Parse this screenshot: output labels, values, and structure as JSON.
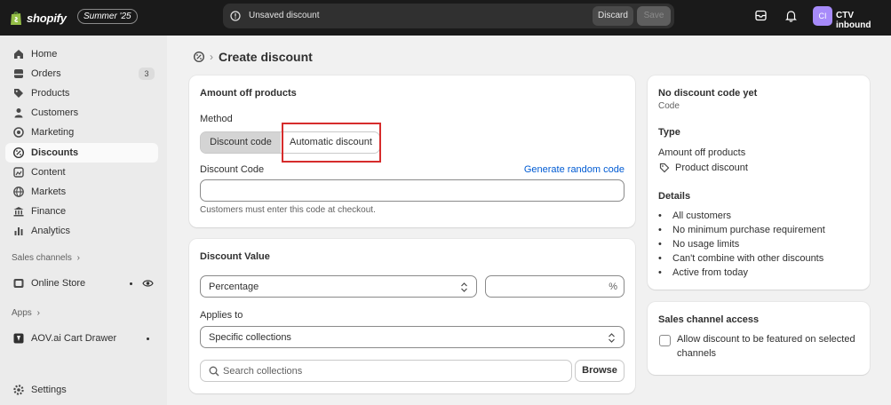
{
  "topbar": {
    "logo_text": "shopify",
    "edition": "Summer '25",
    "unsaved_text": "Unsaved discount",
    "discard_label": "Discard",
    "save_label": "Save",
    "avatar_initials": "CI",
    "store_name": "CTV inbound"
  },
  "sidebar": {
    "items": [
      {
        "label": "Home",
        "icon": "home-icon"
      },
      {
        "label": "Orders",
        "icon": "orders-icon",
        "badge": "3"
      },
      {
        "label": "Products",
        "icon": "tag-icon"
      },
      {
        "label": "Customers",
        "icon": "person-icon"
      },
      {
        "label": "Marketing",
        "icon": "target-icon"
      },
      {
        "label": "Discounts",
        "icon": "discount-icon",
        "active": true
      },
      {
        "label": "Content",
        "icon": "content-icon"
      },
      {
        "label": "Markets",
        "icon": "globe-icon"
      },
      {
        "label": "Finance",
        "icon": "bank-icon"
      },
      {
        "label": "Analytics",
        "icon": "bar-chart-icon"
      }
    ],
    "sales_channels_header": "Sales channels",
    "online_store": "Online Store",
    "apps_header": "Apps",
    "app_name": "AOV.ai Cart Drawer",
    "settings": "Settings"
  },
  "page": {
    "title": "Create discount"
  },
  "method_card": {
    "title": "Amount off products",
    "method_label": "Method",
    "seg_discount_code": "Discount code",
    "seg_automatic": "Automatic discount",
    "code_label": "Discount Code",
    "generate_link": "Generate random code",
    "code_value": "",
    "helper": "Customers must enter this code at checkout."
  },
  "value_card": {
    "title": "Discount Value",
    "type_selected": "Percentage",
    "value": "",
    "suffix": "%",
    "applies_label": "Applies to",
    "applies_selected": "Specific collections",
    "search_placeholder": "Search collections",
    "browse_label": "Browse"
  },
  "summary_card": {
    "code_title": "No discount code yet",
    "code_sub": "Code",
    "type_header": "Type",
    "type_value": "Amount off products",
    "type_tag": "Product discount",
    "details_header": "Details",
    "details": [
      "All customers",
      "No minimum purchase requirement",
      "No usage limits",
      "Can't combine with other discounts",
      "Active from today"
    ]
  },
  "channel_card": {
    "title": "Sales channel access",
    "checkbox_label_line1": "Allow discount to be featured on selected",
    "checkbox_label_line2": "channels",
    "checked": false
  },
  "colors": {
    "accent_link": "#005bd3",
    "highlight": "#d62c2c",
    "topbar": "#1a1a1a",
    "avatar": "#a78bfa"
  }
}
